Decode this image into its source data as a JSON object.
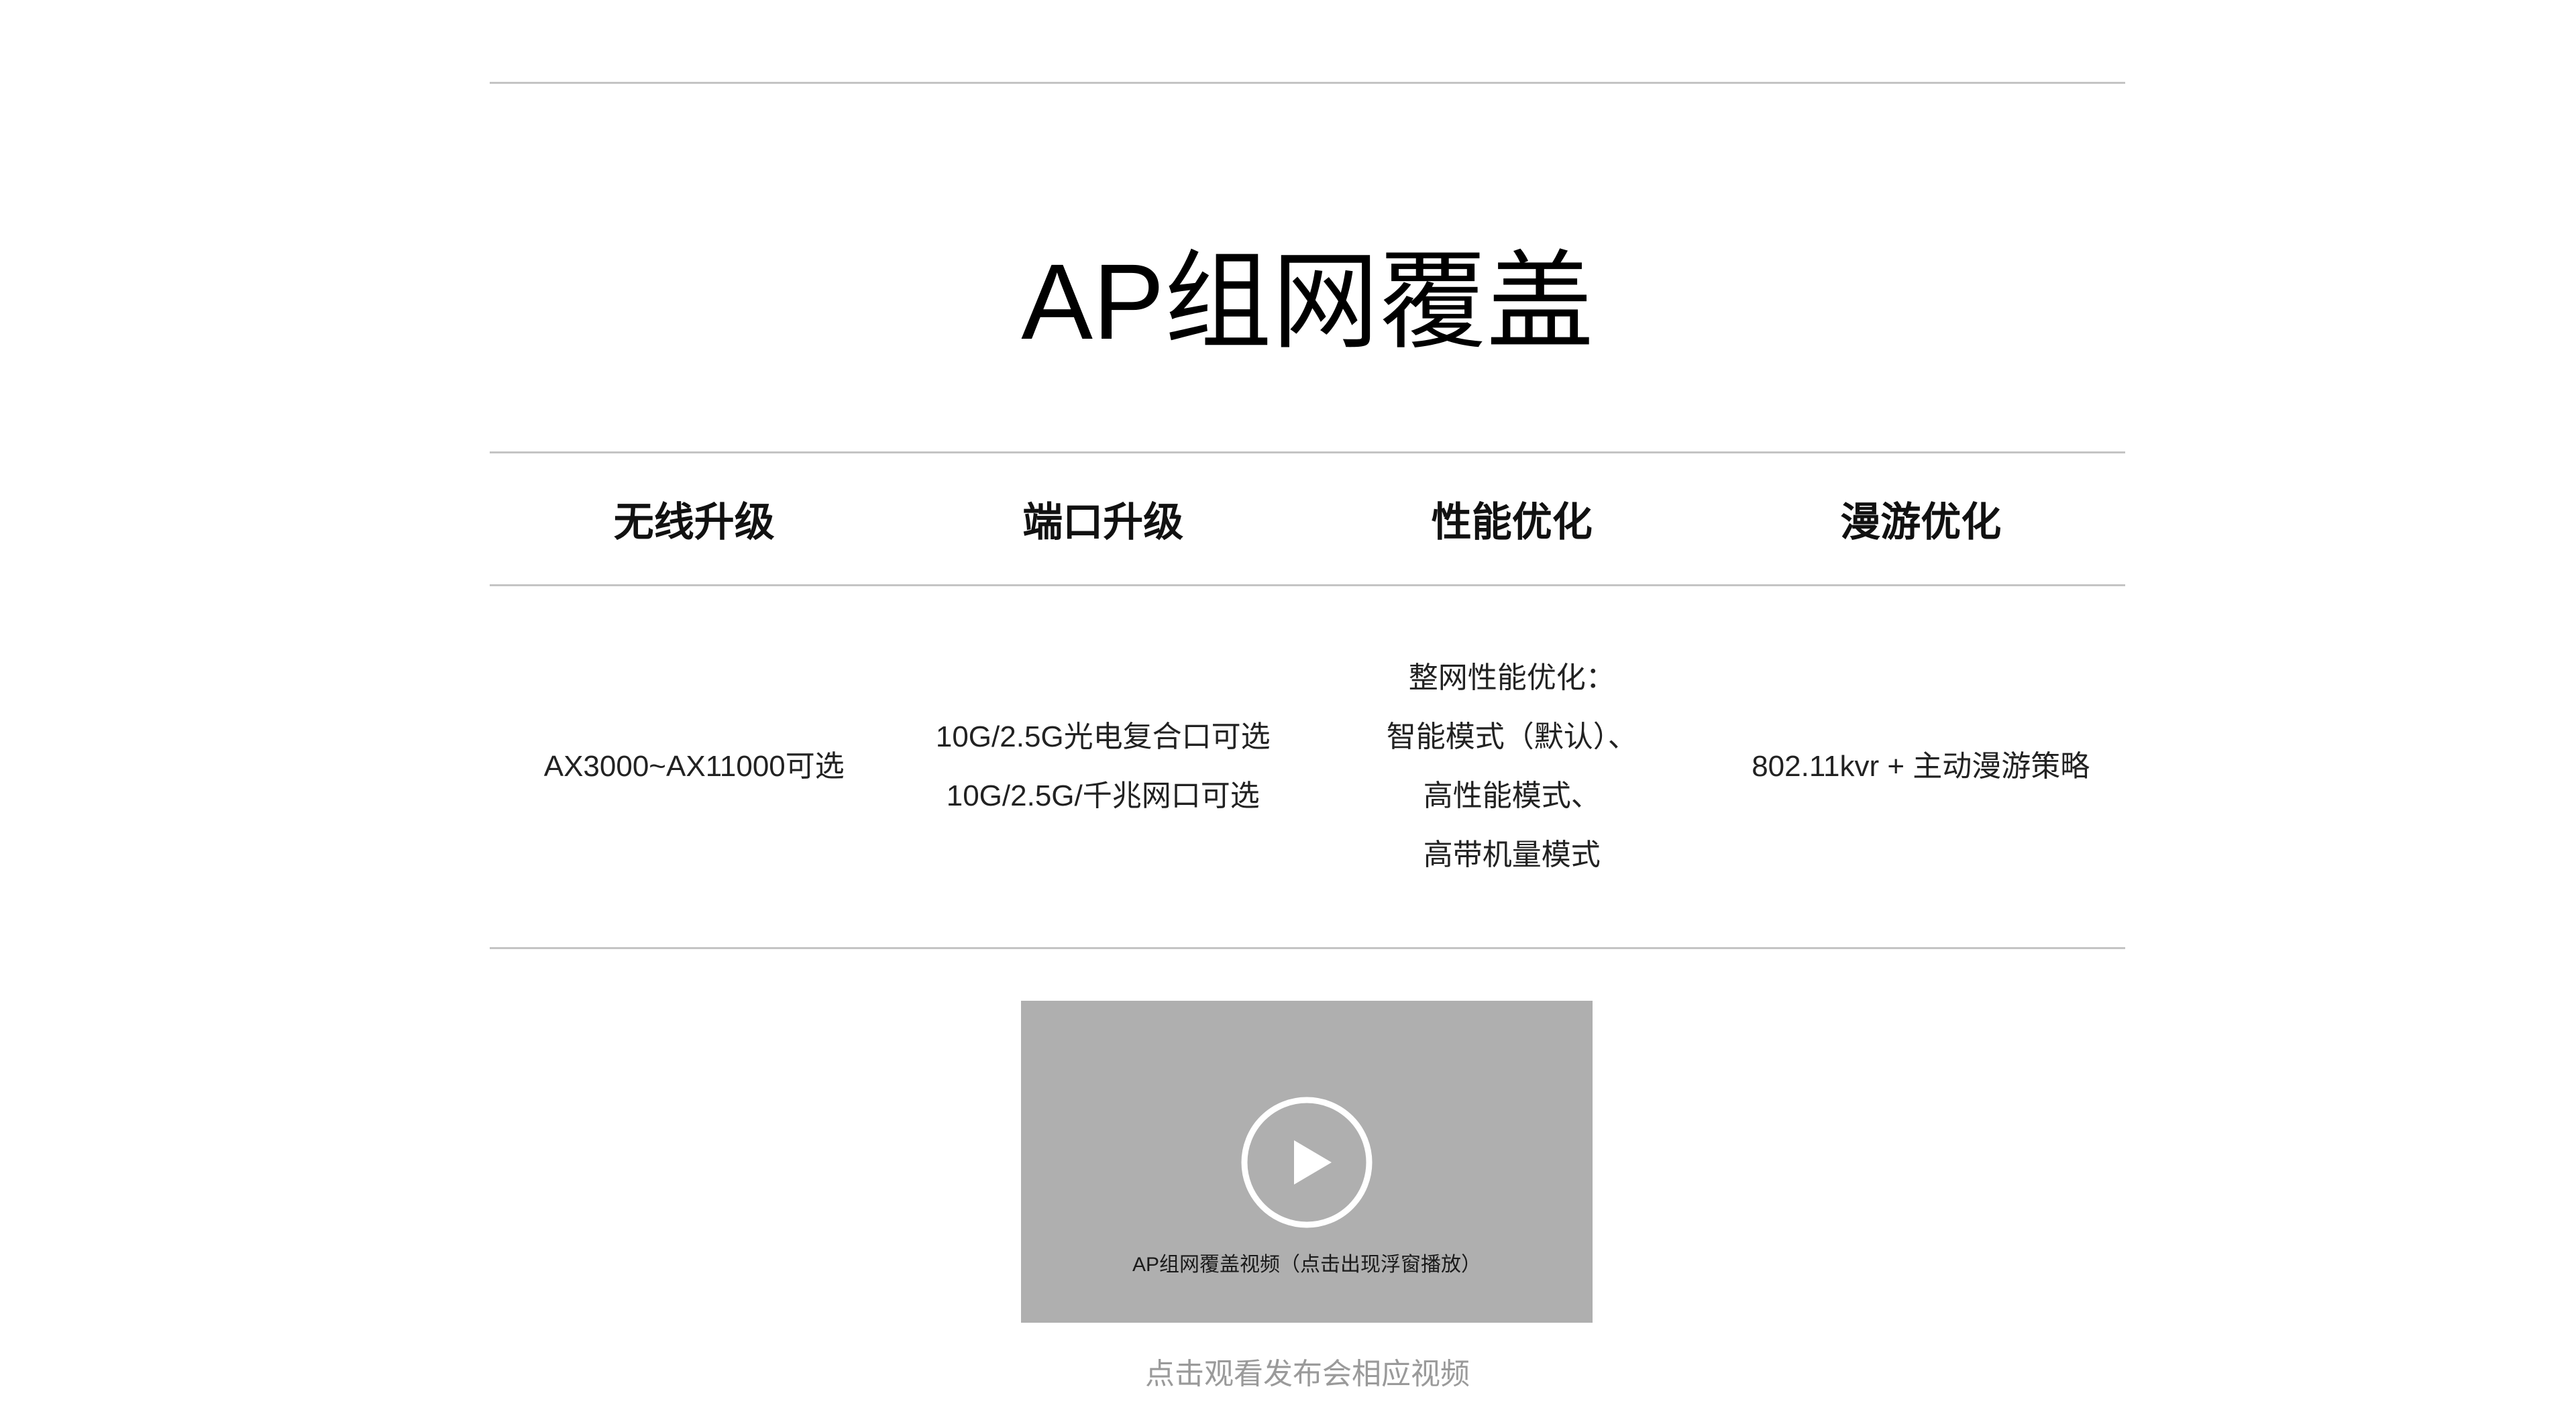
{
  "section": {
    "title": "AP组网覆盖"
  },
  "table": {
    "headers": [
      "无线升级",
      "端口升级",
      "性能优化",
      "漫游优化"
    ],
    "cells": [
      [
        "AX3000~AX11000可选"
      ],
      [
        "10G/2.5G光电复合口可选",
        "10G/2.5G/千兆网口可选"
      ],
      [
        "整网性能优化：",
        "智能模式（默认）、",
        "高性能模式、",
        "高带机量模式"
      ],
      [
        "802.11kvr + 主动漫游策略"
      ]
    ]
  },
  "video": {
    "caption": "AP组网覆盖视频（点击出现浮窗播放）",
    "hint": "点击观看发布会相应视频",
    "play_icon": "play-circle-icon"
  },
  "colors": {
    "rule": "#c4c4c4",
    "video_bg": "#afafaf",
    "hint_text": "#9a9a9a"
  }
}
